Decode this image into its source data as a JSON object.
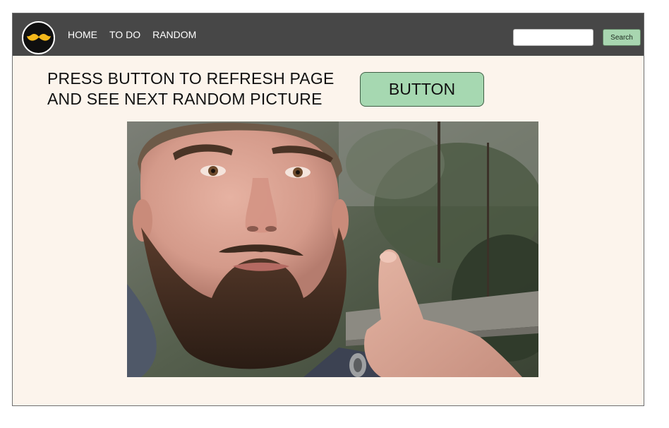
{
  "navbar": {
    "logo_icon": "mustache-icon",
    "links": [
      "HOME",
      "TO DO",
      "RANDOM"
    ],
    "search_placeholder": "",
    "search_label": "Search"
  },
  "main": {
    "instruction_line1": "PRESS BUTTON TO REFRESH PAGE",
    "instruction_line2": "AND SEE NEXT RANDOM PICTURE",
    "button_label": "BUTTON"
  },
  "colors": {
    "navbar_bg": "#474747",
    "page_bg": "#fcf4ec",
    "accent_green": "#a6d8b1",
    "logo_mustache": "#f3b71b"
  }
}
